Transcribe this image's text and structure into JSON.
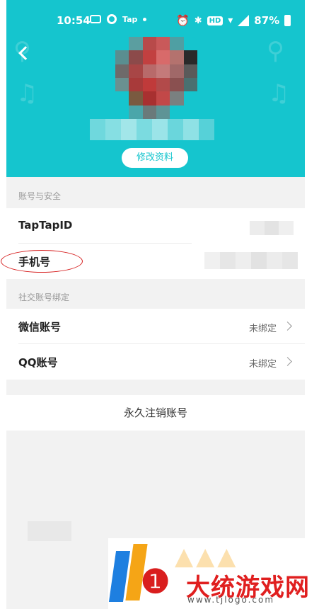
{
  "status_bar": {
    "time": "10:54",
    "carrier_label": "Tap",
    "hd_label": "HD",
    "battery": "87%"
  },
  "header": {
    "edit_profile_label": "修改资料"
  },
  "account_security": {
    "section_title": "账号与安全",
    "rows": [
      {
        "label": "TapTapID"
      },
      {
        "label": "手机号"
      }
    ]
  },
  "social_binding": {
    "section_title": "社交账号绑定",
    "rows": [
      {
        "label": "微信账号",
        "value": "未绑定"
      },
      {
        "label": "QQ账号",
        "value": "未绑定"
      }
    ]
  },
  "delete_account_label": "永久注销账号",
  "watermark": {
    "title": "大统游戏网",
    "url": "www.tjlogo.com"
  },
  "colors": {
    "accent": "#15c5ce",
    "background": "#f2f2f2",
    "annotation": "#d62020"
  }
}
